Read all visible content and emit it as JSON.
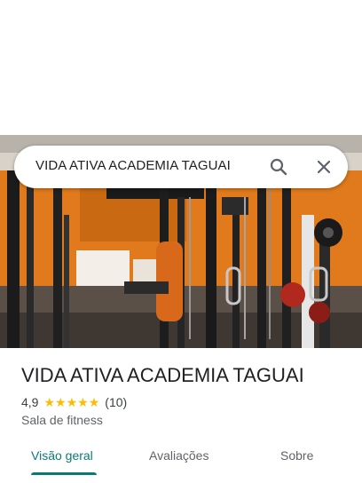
{
  "search": {
    "query": "VIDA ATIVA ACADEMIA TAGUAI",
    "search_icon": "search-icon",
    "close_icon": "close-icon"
  },
  "place": {
    "title": "VIDA ATIVA ACADEMIA TAGUAI",
    "rating": "4,9",
    "stars": 5,
    "review_count": "(10)",
    "category": "Sala de fitness"
  },
  "tabs": [
    {
      "label": "Visão geral",
      "active": true
    },
    {
      "label": "Avaliações",
      "active": false
    },
    {
      "label": "Sobre",
      "active": false
    }
  ],
  "colors": {
    "accent": "#0b7a75",
    "star": "#fbbc04",
    "wall_orange": "#e07a1c"
  }
}
